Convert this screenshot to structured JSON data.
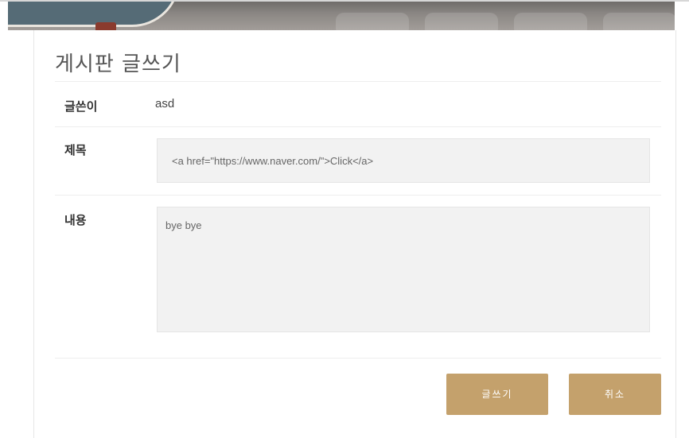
{
  "page": {
    "title": "게시판 글쓰기"
  },
  "form": {
    "author_label": "글쓴이",
    "author_value": "asd",
    "subject_label": "제목",
    "subject_value": "<a href=\"https://www.naver.com/\">Click</a>",
    "content_label": "내용",
    "content_value": "bye bye"
  },
  "buttons": {
    "write_label": "글쓰기",
    "cancel_label": "취소"
  },
  "colors": {
    "accent": "#c4a16c",
    "field_background": "#f2f2f2",
    "header_bar": "#8a8683"
  }
}
